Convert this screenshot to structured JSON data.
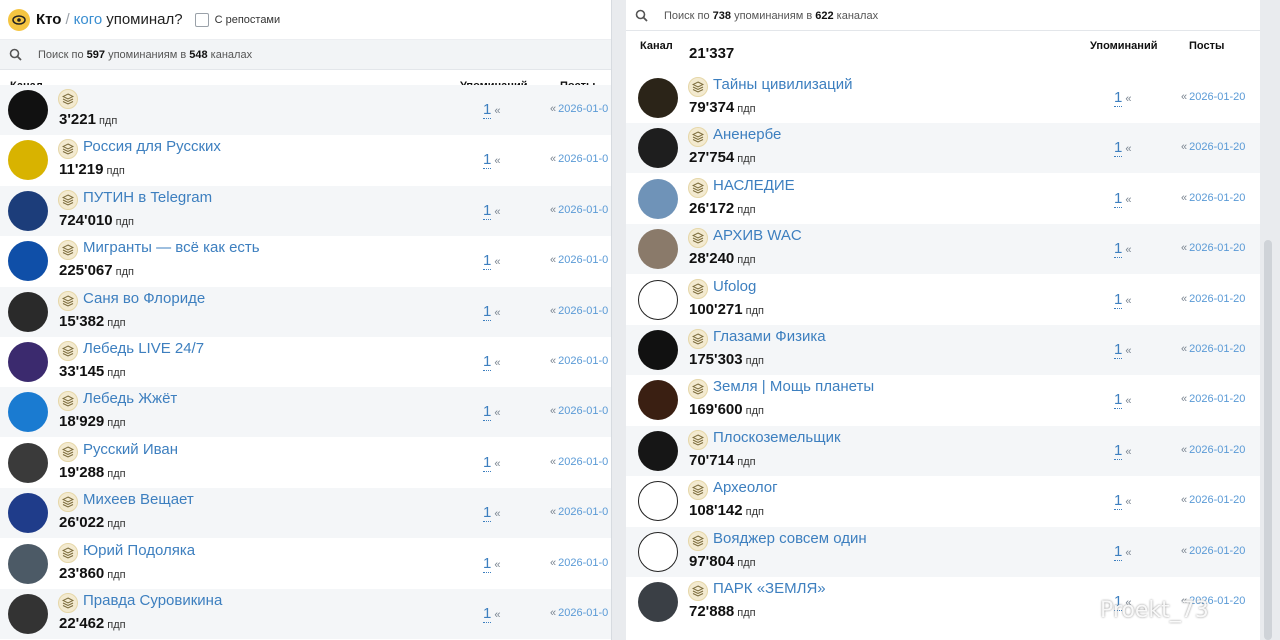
{
  "left": {
    "header": {
      "kto": "Кто",
      "sep": "/",
      "kogo": "кого",
      "upominal": "упоминал?",
      "reposts_label": "С репостами"
    },
    "search": {
      "prefix": "Поиск по ",
      "count": "597",
      "mid": " упоминаниям в ",
      "channels": "548",
      "suffix": " каналах"
    },
    "columns": {
      "channel": "Канал",
      "mentions": "Упоминаний",
      "posts": "Посты"
    },
    "rows": [
      {
        "name": "",
        "subs": "3'221",
        "unit": "пдп",
        "mentions": "1",
        "date": "2026-01-0",
        "avatar_color": "#111111"
      },
      {
        "name": "Россия для Русских",
        "subs": "11'219",
        "unit": "пдп",
        "mentions": "1",
        "date": "2026-01-0",
        "avatar_color": "#d8b300"
      },
      {
        "name": "ПУТИН в Telegram",
        "subs": "724'010",
        "unit": "пдп",
        "mentions": "1",
        "date": "2026-01-0",
        "avatar_color": "#1c3d7a"
      },
      {
        "name": "Мигранты — всё как есть",
        "subs": "225'067",
        "unit": "пдп",
        "mentions": "1",
        "date": "2026-01-0",
        "avatar_color": "#0f4fa8"
      },
      {
        "name": "Саня во Флориде",
        "subs": "15'382",
        "unit": "пдп",
        "mentions": "1",
        "date": "2026-01-0",
        "avatar_color": "#2a2a2a"
      },
      {
        "name": "Лебедь LIVE 24/7",
        "subs": "33'145",
        "unit": "пдп",
        "mentions": "1",
        "date": "2026-01-0",
        "avatar_color": "#3b2a6e"
      },
      {
        "name": "Лебедь Жжёт",
        "subs": "18'929",
        "unit": "пдп",
        "mentions": "1",
        "date": "2026-01-0",
        "avatar_color": "#1a7bd1"
      },
      {
        "name": "Русский Иван",
        "subs": "19'288",
        "unit": "пдп",
        "mentions": "1",
        "date": "2026-01-0",
        "avatar_color": "#3a3a3a"
      },
      {
        "name": "Михеев Вещает",
        "subs": "26'022",
        "unit": "пдп",
        "mentions": "1",
        "date": "2026-01-0",
        "avatar_color": "#1f3c8a"
      },
      {
        "name": "Юрий Подоляка",
        "subs": "23'860",
        "unit": "пдп",
        "mentions": "1",
        "date": "2026-01-0",
        "avatar_color": "#4c5a66"
      },
      {
        "name": "Правда Суровикина",
        "subs": "22'462",
        "unit": "пдп",
        "mentions": "1",
        "date": "2026-01-0",
        "avatar_color": "#333333"
      }
    ]
  },
  "right": {
    "search": {
      "prefix": "Поиск по ",
      "count": "738",
      "mid": " упоминаниям в ",
      "channels": "622",
      "suffix": " каналах"
    },
    "columns": {
      "channel": "Канал",
      "mentions": "Упоминаний",
      "posts": "Посты"
    },
    "partial_top": "21'337",
    "rows": [
      {
        "name": "Тайны цивилизаций",
        "subs": "79'374",
        "unit": "пдп",
        "mentions": "1",
        "date": "2026-01-20",
        "avatar_color": "#2b2418"
      },
      {
        "name": "Аненербе",
        "subs": "27'754",
        "unit": "пдп",
        "mentions": "1",
        "date": "2026-01-20",
        "avatar_color": "#1e1e1e"
      },
      {
        "name": "НАСЛЕДИЕ",
        "subs": "26'172",
        "unit": "пдп",
        "mentions": "1",
        "date": "2026-01-20",
        "avatar_color": "#6f93b8"
      },
      {
        "name": "АРХИВ WAC",
        "subs": "28'240",
        "unit": "пдп",
        "mentions": "1",
        "date": "2026-01-20",
        "avatar_color": "#8a7a6a"
      },
      {
        "name": "Ufolog",
        "subs": "100'271",
        "unit": "пдп",
        "mentions": "1",
        "date": "2026-01-20",
        "avatar_color": "#ffffff"
      },
      {
        "name": "Глазами Физика",
        "subs": "175'303",
        "unit": "пдп",
        "mentions": "1",
        "date": "2026-01-20",
        "avatar_color": "#111111"
      },
      {
        "name": "Земля | Мощь планеты",
        "subs": "169'600",
        "unit": "пдп",
        "mentions": "1",
        "date": "2026-01-20",
        "avatar_color": "#3a1f12"
      },
      {
        "name": "Плоскоземельщик",
        "subs": "70'714",
        "unit": "пдп",
        "mentions": "1",
        "date": "2026-01-20",
        "avatar_color": "#161616"
      },
      {
        "name": "Археолог",
        "subs": "108'142",
        "unit": "пдп",
        "mentions": "1",
        "date": "2026-01-20",
        "avatar_color": "#ffffff"
      },
      {
        "name": "Вояджер совсем один",
        "subs": "97'804",
        "unit": "пдп",
        "mentions": "1",
        "date": "2026-01-20",
        "avatar_color": "#ffffff"
      },
      {
        "name": "ПАРК «ЗЕМЛЯ»",
        "subs": "72'888",
        "unit": "пдп",
        "mentions": "1",
        "date": "2026-01-20",
        "avatar_color": "#3a3f45"
      }
    ]
  },
  "watermark": "Proekt_73",
  "icons": {
    "eye": "eye-icon",
    "search": "search-icon",
    "badge": "stack-icon",
    "quote": "quote-icon"
  },
  "colors": {
    "link": "#3d7fbf",
    "accent": "#f5c542"
  }
}
